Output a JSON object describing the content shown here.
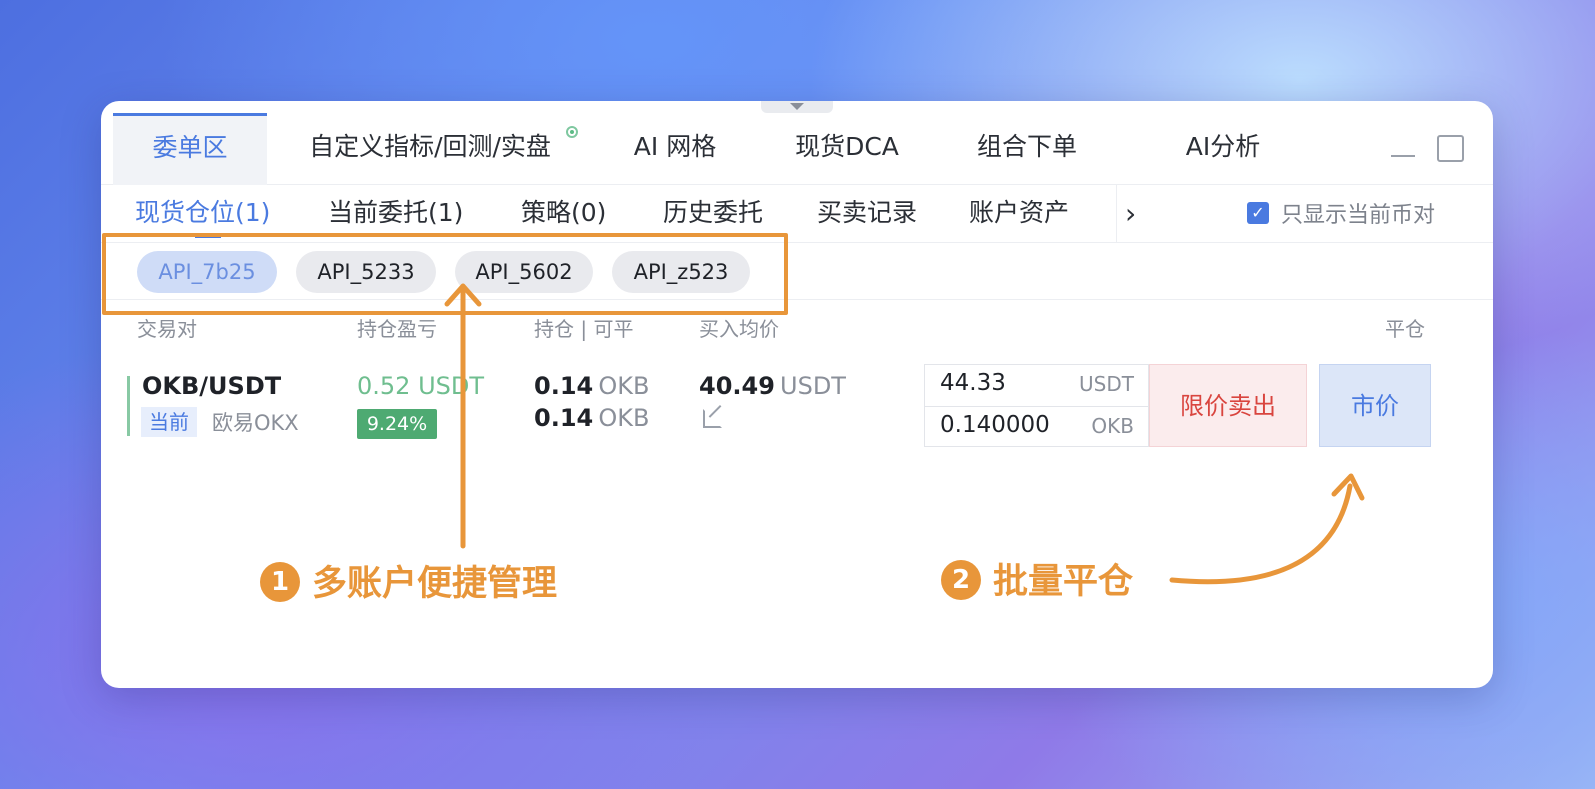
{
  "top_tabs": [
    {
      "label": "委单区",
      "active": true
    },
    {
      "label": "自定义指标/回测/实盘"
    },
    {
      "label": "AI 网格"
    },
    {
      "label": "现货DCA"
    },
    {
      "label": "组合下单"
    },
    {
      "label": "AI分析"
    }
  ],
  "sub_tabs": [
    {
      "label": "现货仓位(1)",
      "active": true
    },
    {
      "label": "当前委托(1)"
    },
    {
      "label": "策略(0)"
    },
    {
      "label": "历史委托"
    },
    {
      "label": "买卖记录"
    },
    {
      "label": "账户资产"
    }
  ],
  "filter": {
    "label": "只显示当前币对",
    "checked": true
  },
  "accounts": [
    {
      "label": "API_7b25",
      "active": true
    },
    {
      "label": "API_5233"
    },
    {
      "label": "API_5602"
    },
    {
      "label": "API_z523"
    }
  ],
  "columns": {
    "pair": "交易对",
    "pnl": "持仓盈亏",
    "position": "持仓 | 可平",
    "avg_price": "买入均价",
    "close": "平仓"
  },
  "row": {
    "pair": "OKB/USDT",
    "current_badge": "当前",
    "exchange": "欧易OKX",
    "pnl_value": "0.52 USDT",
    "pnl_percent": "9.24%",
    "hold_amount": "0.14",
    "hold_unit": "OKB",
    "closable_amount": "0.14",
    "closable_unit": "OKB",
    "avg_price": "40.49",
    "avg_unit": "USDT",
    "order_price": "44.33",
    "order_price_unit": "USDT",
    "order_qty": "0.140000",
    "order_qty_unit": "OKB",
    "limit_sell_label": "限价卖出",
    "market_label": "市价"
  },
  "annotations": {
    "one_num": "1",
    "one_text": "多账户便捷管理",
    "two_num": "2",
    "two_text": "批量平仓",
    "accent": "#e8963a"
  },
  "colors": {
    "primary": "#4a7ae0",
    "profit": "#4eaa72",
    "sell": "#d9453f"
  }
}
